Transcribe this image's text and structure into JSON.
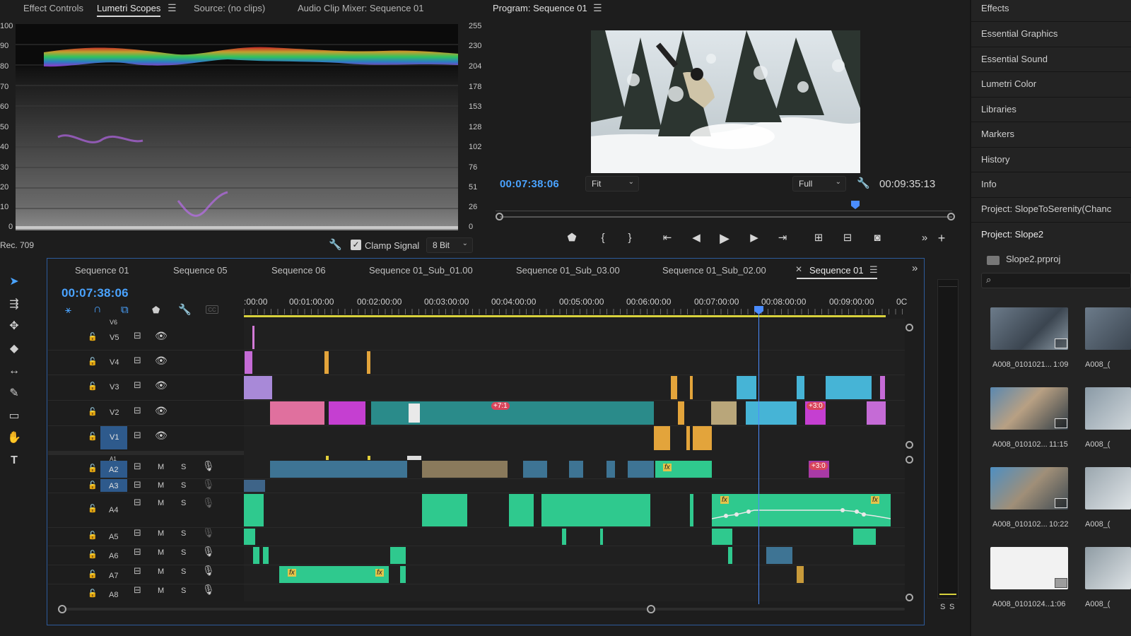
{
  "top_tabs": [
    {
      "label": "Effect Controls",
      "active": false
    },
    {
      "label": "Lumetri Scopes",
      "active": true
    },
    {
      "label": "Source: (no clips)",
      "active": false
    },
    {
      "label": "Audio Clip Mixer: Sequence 01",
      "active": false
    }
  ],
  "scopes": {
    "left_axis": [
      "100",
      "90",
      "80",
      "70",
      "60",
      "50",
      "40",
      "30",
      "20",
      "10",
      "0"
    ],
    "right_axis": [
      "255",
      "230",
      "204",
      "178",
      "153",
      "128",
      "102",
      "76",
      "51",
      "26",
      "0"
    ],
    "color_space": "Rec. 709",
    "clamp_label": "Clamp Signal",
    "clamp_checked": true,
    "bit_depth": "8 Bit"
  },
  "program": {
    "title": "Program: Sequence 01",
    "current_time": "00:07:38:06",
    "duration": "00:09:35:13",
    "zoom": "Fit",
    "resolution": "Full",
    "playhead_fraction": 0.786
  },
  "right_panel": {
    "items": [
      "Effects",
      "Essential Graphics",
      "Essential Sound",
      "Lumetri Color",
      "Libraries",
      "Markers",
      "History",
      "Info",
      "Project: SlopeToSerenity(Chanc"
    ],
    "project_title": "Project: Slope2",
    "project_file": "Slope2.prproj",
    "thumbnails": [
      {
        "name": "A008_0101021...",
        "duration": "1:09"
      },
      {
        "name": "A008_010102...",
        "duration": "11:15"
      },
      {
        "name": "A008_010102...",
        "duration": "10:22"
      },
      {
        "name": "A008_0101024...",
        "duration": "1:06"
      }
    ],
    "thumb_col2_caption": "A008_("
  },
  "timeline": {
    "tabs": [
      "Sequence 01",
      "Sequence 05",
      "Sequence 06",
      "Sequence 01_Sub_01.00",
      "Sequence 01_Sub_03.00",
      "Sequence 01_Sub_02.00",
      "Sequence 01"
    ],
    "active_tab_index": 6,
    "current_time": "00:07:38:06",
    "ruler": [
      ":00:00",
      "00:01:00:00",
      "00:02:00:00",
      "00:03:00:00",
      "00:04:00:00",
      "00:05:00:00",
      "00:06:00:00",
      "00:07:00:00",
      "00:08:00:00",
      "00:09:00:00",
      "0C"
    ],
    "video_tracks": [
      "V6",
      "V5",
      "V4",
      "V3",
      "V2",
      "V1"
    ],
    "audio_tracks": [
      "A1",
      "A2",
      "A3",
      "A4",
      "A5",
      "A6",
      "A7",
      "A8"
    ],
    "mute_label": "M",
    "solo_label": "S",
    "clip_badges": [
      "+7:1",
      "+3:0",
      "+3:0"
    ],
    "fx_label": "fx",
    "meter_labels": [
      "S",
      "S"
    ]
  },
  "colors": {
    "accent_blue": "#4aa3ff",
    "pink_clip": "#e0709e",
    "magenta_clip": "#c53fd1",
    "teal_clip": "#2a8b8a",
    "cyan_clip": "#46b4d6",
    "orange_clip": "#e3a43b",
    "tan_clip": "#b9a67a",
    "lilac_clip": "#a889d8",
    "audio_green": "#2fc98e",
    "audio_blue": "#3e7494"
  }
}
